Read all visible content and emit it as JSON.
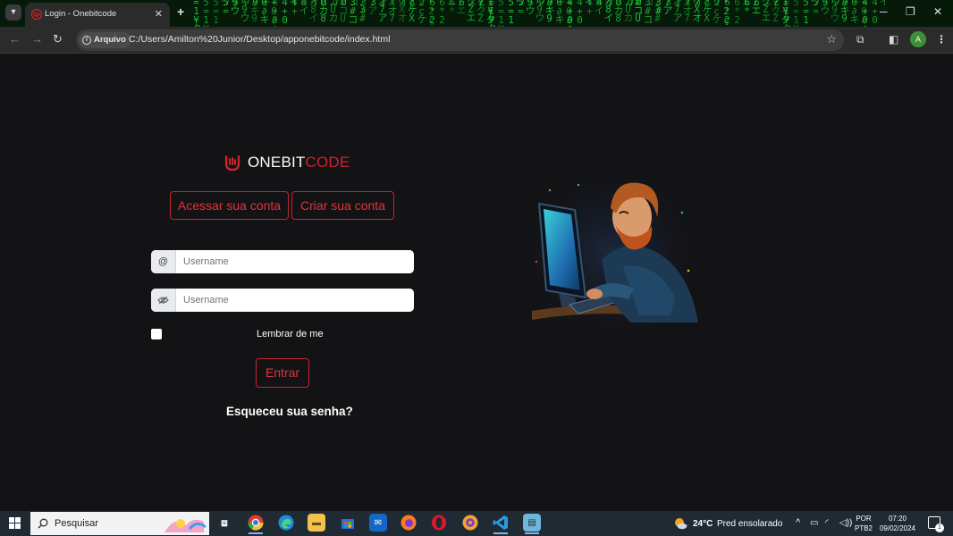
{
  "browser": {
    "tab_title": "Login - Onebitcode",
    "tab_close": "✕",
    "new_tab": "+",
    "window_controls": {
      "minimize": "─",
      "maximize": "❐",
      "close": "✕"
    },
    "security_chip": "Arquivo",
    "url": "C:/Users/Amilton%20Junior/Desktop/apponebitcode/index.html",
    "profile_initial": "A"
  },
  "login": {
    "brand_white": "ONEBIT",
    "brand_red": "CODE",
    "login_tab": "Acessar sua conta",
    "signup_tab": "Criar sua conta",
    "username_addon": "@",
    "username_placeholder": "Username",
    "password_placeholder": "Username",
    "remember_label": "Lembrar de me",
    "submit_label": "Entrar",
    "forgot_label": "Esqueceu sua senha?"
  },
  "taskbar": {
    "search_placeholder": "Pesquisar",
    "weather_temp": "24°C",
    "weather_desc": "Pred ensolarado",
    "lang_line1": "POR",
    "lang_line2": "PTB2",
    "time": "07:20",
    "date": "09/02/2024",
    "notification_count": "1"
  },
  "colors": {
    "accent_red": "#d1232a",
    "page_background": "#131316",
    "browser_chrome": "#2b2b2b",
    "taskbar": "#1f2a33"
  },
  "icons": [
    "tab-list-icon",
    "favicon-icon",
    "back-icon",
    "forward-icon",
    "reload-icon",
    "info-icon",
    "bookmark-star-icon",
    "extensions-icon",
    "side-panel-icon",
    "menu-icon",
    "onebitcode-logo-icon",
    "at-icon",
    "eye-slash-icon",
    "windows-start-icon",
    "search-icon",
    "task-view-icon",
    "chrome-icon",
    "edge-icon",
    "file-explorer-icon",
    "store-icon",
    "mail-icon",
    "firefox-icon",
    "opera-icon",
    "brave-icon",
    "vscode-icon",
    "notepad-icon",
    "weather-icon",
    "chevron-up-icon",
    "battery-icon",
    "wifi-icon",
    "volume-icon",
    "notification-icon"
  ]
}
